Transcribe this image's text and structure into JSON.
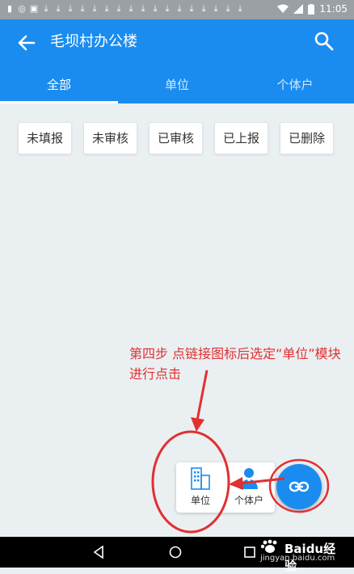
{
  "status_bar": {
    "time": "11:05"
  },
  "header": {
    "title": "毛坝村办公楼"
  },
  "tabs": [
    "全部",
    "单位",
    "个体户"
  ],
  "filters": [
    "未填报",
    "未审核",
    "已审核",
    "已上报",
    "已删除"
  ],
  "annotation": "第四步 点链接图标后选定“单位”模块进行点击",
  "fab_menu": {
    "unit_label": "单位",
    "individual_label": "个体户"
  },
  "watermark": {
    "brand": "Baidu经验",
    "url": "jingyan.baidu.com"
  },
  "colors": {
    "primary": "#1a8cf0",
    "annotation": "#e03030",
    "background": "#eaeff2"
  }
}
